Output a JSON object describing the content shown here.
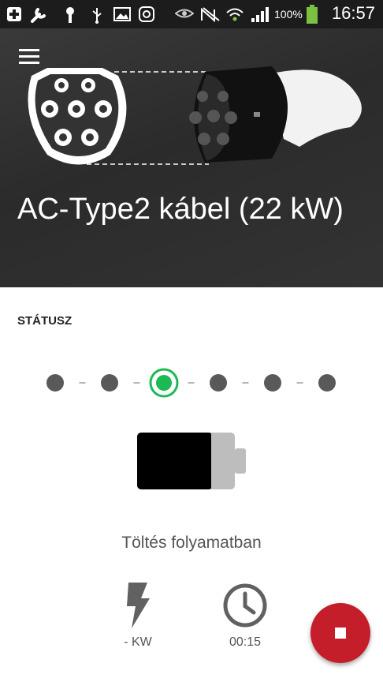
{
  "statusbar": {
    "battery_percent": "100%",
    "time": "16:57",
    "icons": [
      "plus-icon",
      "wrench-icon",
      "key-icon",
      "usb-icon",
      "image-icon",
      "instagram-icon",
      "eye-icon",
      "no-signal-icon",
      "wifi-icon",
      "signal-bars-icon",
      "battery-icon"
    ]
  },
  "header": {
    "menu_icon": "hamburger-menu-icon",
    "title": "AC-Type2 kábel (22 kW)"
  },
  "status": {
    "label": "STÁTUSZ",
    "steps_total": 6,
    "active_step": 3,
    "charging_text": "Töltés folyamatban"
  },
  "stats": {
    "power_value": "- KW",
    "power_icon": "lightning-icon",
    "time_value": "00:15",
    "time_icon": "clock-icon"
  },
  "actions": {
    "stop_icon": "stop-icon"
  },
  "colors": {
    "accent_green": "#1db954",
    "stop_red": "#c41e2a",
    "step_gray": "#595959",
    "hero_bg": "#2f2f2f"
  }
}
